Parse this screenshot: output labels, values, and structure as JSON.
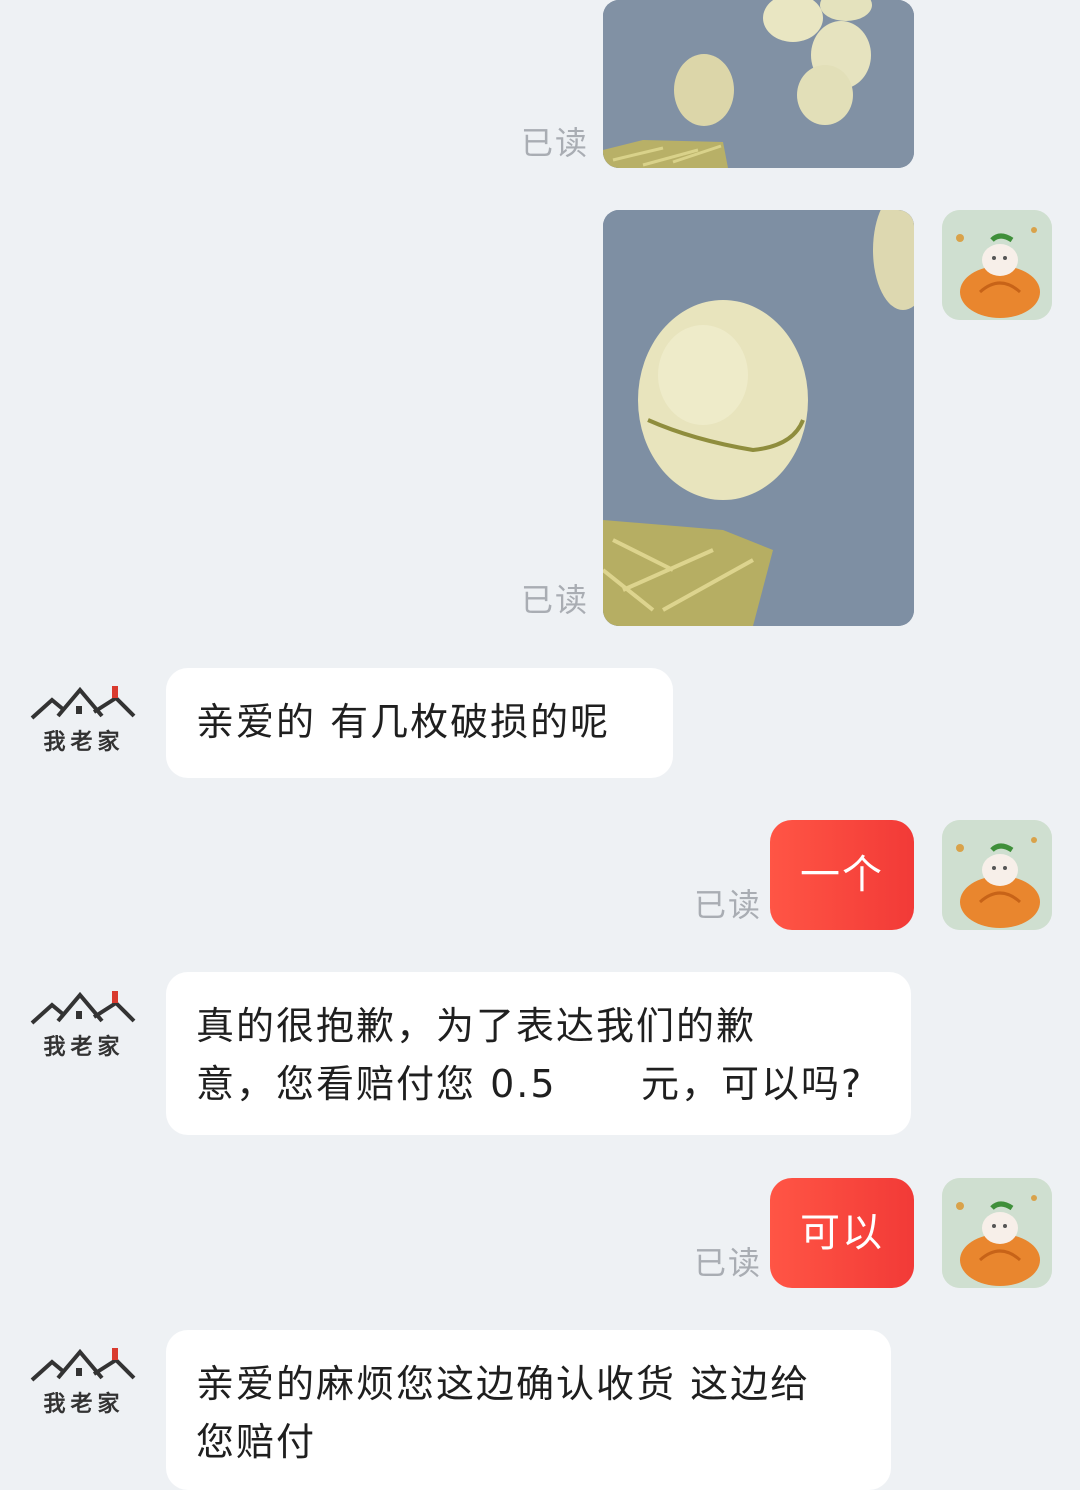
{
  "shop": {
    "name": "我老家"
  },
  "messages": [
    {
      "type": "image",
      "from": "user",
      "status": "已读"
    },
    {
      "type": "image",
      "from": "user",
      "status": "已读"
    },
    {
      "type": "text",
      "from": "shop",
      "text": "亲爱的 有几枚破损的呢"
    },
    {
      "type": "text",
      "from": "user",
      "text": "一个",
      "status": "已读"
    },
    {
      "type": "text",
      "from": "shop",
      "line1": "真的很抱歉，为了表达我们的歉",
      "line2": "意，您看赔付您 0.5      元，可以吗?"
    },
    {
      "type": "text",
      "from": "user",
      "text": "可以",
      "status": "已读"
    },
    {
      "type": "text",
      "from": "shop",
      "line1": "亲爱的麻烦您这边确认收货 这边给",
      "line2": "您赔付"
    }
  ],
  "colors": {
    "background": "#eef1f4",
    "outgoing_bubble": "#f23a37",
    "incoming_bubble": "#ffffff",
    "read_status": "#a9adb3"
  }
}
